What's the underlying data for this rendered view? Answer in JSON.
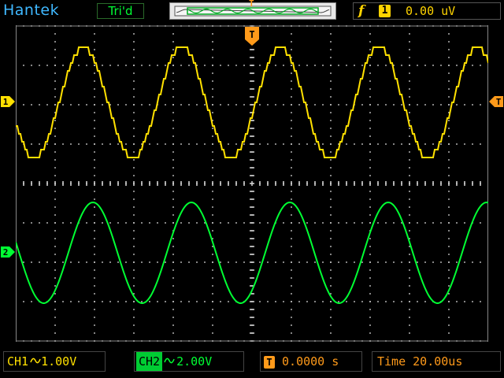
{
  "brand": "Hantek",
  "trigger_state": "Tri'd",
  "trigger": {
    "source_symbol": "f",
    "source_channel": "1",
    "level": "0.00  uV",
    "marker_label": "T"
  },
  "channels": {
    "ch1": {
      "label": "1",
      "color": "#ffe000",
      "readout_name": "CH1",
      "coupling_icon": "ac-coupling-icon",
      "volts_div": "1.00V"
    },
    "ch2": {
      "label": "2",
      "color": "#00ff33",
      "readout_name": "CH2",
      "coupling_icon": "ac-coupling-icon",
      "volts_div": "2.00V"
    }
  },
  "horizontal": {
    "position_icon": "T→",
    "position": "0.0000 s",
    "timebase": "Time 20.00us"
  },
  "colors": {
    "grid": "#d0d0d0",
    "accent": "#3fb8ff",
    "trigger": "#ff9a1a"
  }
}
